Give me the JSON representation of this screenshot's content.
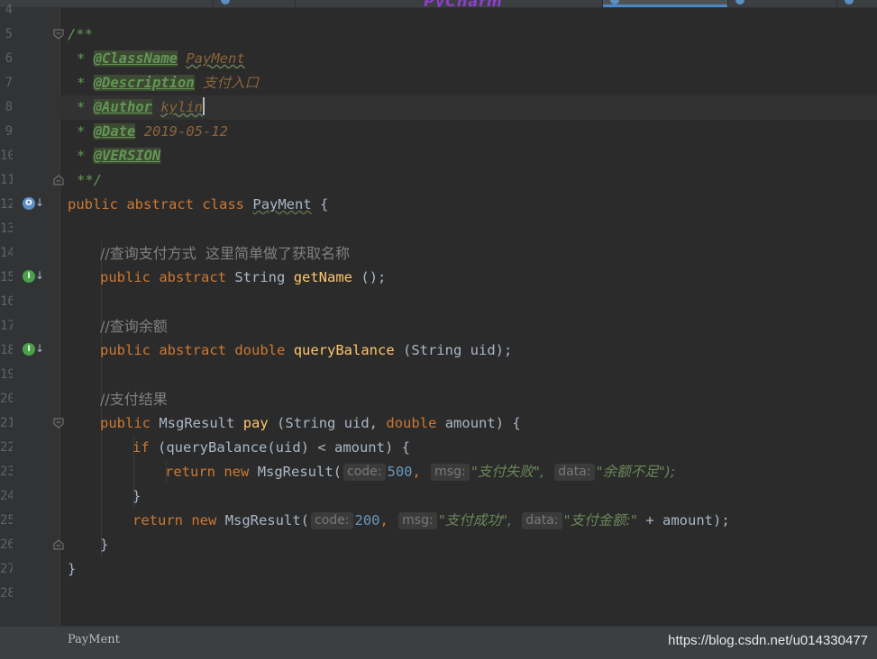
{
  "editor": {
    "line_numbers": [
      "4",
      "5",
      "6",
      "7",
      "8",
      "9",
      "10",
      "11",
      "12",
      "13",
      "14",
      "15",
      "16",
      "17",
      "18",
      "19",
      "20",
      "21",
      "22",
      "23",
      "24",
      "25",
      "26",
      "27",
      "28"
    ],
    "lines": {
      "l5": "/**",
      "l6_tag": "@ClassName",
      "l6_val": "PayMent",
      "l7_tag": "@Description",
      "l7_val": "支付入口",
      "l8_tag": "@Author",
      "l8_val": "kylin",
      "l9_tag": "@Date",
      "l9_val": "2019-05-12",
      "l10_tag": "@VERSION",
      "l11": "**/",
      "l12_kw1": "public",
      "l12_kw2": "abstract",
      "l12_kw3": "class",
      "l12_name": "PayMent",
      "l12_brace": "{",
      "l14_comment": "//查询支付方式  这里简单做了获取名称",
      "l15_kw1": "public",
      "l15_kw2": "abstract",
      "l15_type": "String",
      "l15_fn": "getName",
      "l15_rest": "();",
      "l17_comment": "//查询余额",
      "l18_kw1": "public",
      "l18_kw2": "abstract",
      "l18_kw3": "double",
      "l18_fn": "queryBalance",
      "l18_rest": "(String uid);",
      "l20_comment": "//支付结果",
      "l21_kw1": "public",
      "l21_type": "MsgResult",
      "l21_fn": "pay",
      "l21_p1": "(String uid,",
      "l21_kw2": "double",
      "l21_p2": "amount) {",
      "l22_kw": "if",
      "l22_rest": "(queryBalance(uid) < amount) {",
      "l23_kw1": "return",
      "l23_kw2": "new",
      "l23_call": "MsgResult(",
      "l23_hint1": "code:",
      "l23_num": "500",
      "l23_hint2": "msg:",
      "l23_str1": "\"支付失败\",",
      "l23_hint3": "data:",
      "l23_str2": "\"余额不足\");",
      "l24": "}",
      "l25_kw1": "return",
      "l25_kw2": "new",
      "l25_call": "MsgResult(",
      "l25_hint1": "code:",
      "l25_num": "200",
      "l25_hint2": "msg:",
      "l25_str1": "\"支付成功\",",
      "l25_hint3": "data:",
      "l25_str2": "\"支付金额:\"",
      "l25_rest": "+ amount);",
      "l26": "}",
      "l27": "}"
    },
    "gutter_icons": {
      "override": "O",
      "implemented": "I"
    }
  },
  "statusbar": {
    "breadcrumb": "PayMent",
    "watermark": "https://blog.csdn.net/u014330477"
  },
  "colors": {
    "background": "#2b2b2b",
    "keyword": "#cc7832",
    "function": "#ffc66d",
    "doc_comment": "#629755",
    "string": "#6a8759",
    "number": "#6897bb"
  }
}
